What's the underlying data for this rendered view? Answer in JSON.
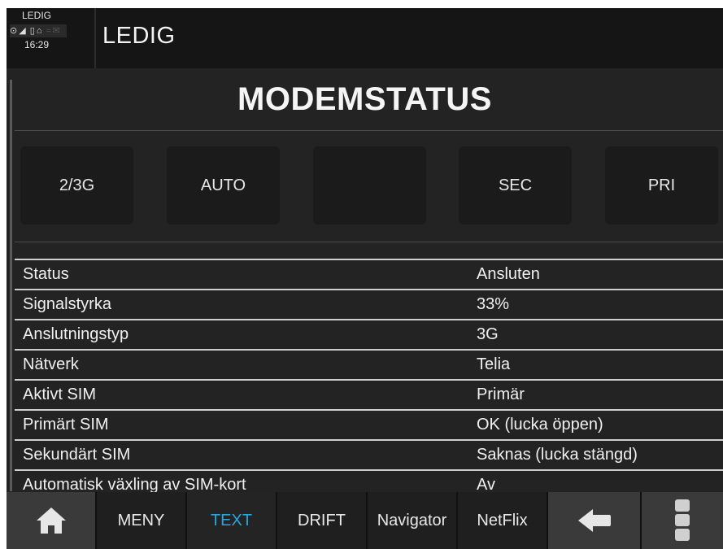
{
  "status_panel": {
    "mode": "LEDIG",
    "time": "16:29"
  },
  "header": {
    "title": "LEDIG"
  },
  "page": {
    "title": "MODEMSTATUS"
  },
  "mode_buttons": [
    "2/3G",
    "AUTO",
    "",
    "SEC",
    "PRI"
  ],
  "table": {
    "rows": [
      {
        "label": "Status",
        "value": "Ansluten"
      },
      {
        "label": "Signalstyrka",
        "value": "33%"
      },
      {
        "label": "Anslutningstyp",
        "value": "3G"
      },
      {
        "label": "Nätverk",
        "value": "Telia"
      },
      {
        "label": "Aktivt SIM",
        "value": "Primär"
      },
      {
        "label": "Primärt SIM",
        "value": "OK (lucka öppen)"
      },
      {
        "label": "Sekundärt SIM",
        "value": "Saknas (lucka stängd)"
      },
      {
        "label": "Automatisk växling av SIM-kort",
        "value": "Av"
      }
    ]
  },
  "nav": {
    "items": [
      "MENY",
      "TEXT",
      "DRIFT",
      "Navigator",
      "NetFlix"
    ],
    "active": "TEXT",
    "icons": {
      "home": "home-icon",
      "back": "back-arrow-icon",
      "more": "more-vertical-icon"
    }
  },
  "colors": {
    "background": "#232323",
    "header": "#151515",
    "active_tab": "#29a7d8"
  }
}
